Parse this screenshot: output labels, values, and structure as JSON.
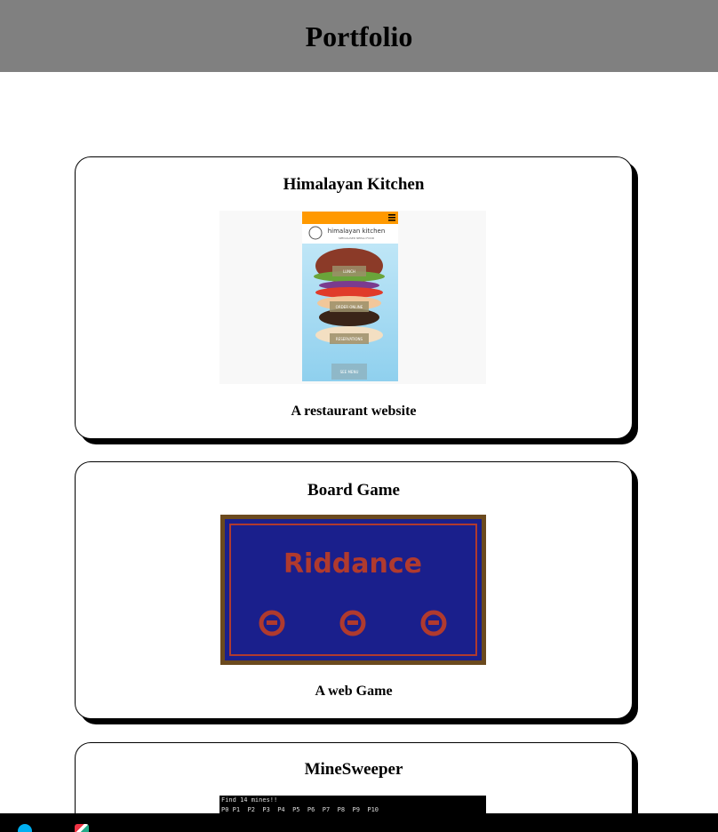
{
  "header": {
    "title": "Portfolio"
  },
  "projects": [
    {
      "title": "Himalayan Kitchen",
      "description": "A restaurant website",
      "preview": {
        "brand": "himalayan kitchen",
        "tagline": "SPECIALISED NEPALI FOOD",
        "buttons": [
          "LUNCH",
          "ORDER ONLINE",
          "RESERVATIONS",
          "SEE MENU"
        ]
      }
    },
    {
      "title": "Board Game",
      "description": "A web Game",
      "preview": {
        "logo": "Riddance"
      }
    },
    {
      "title": "MineSweeper",
      "description": "",
      "preview": {
        "line1": "Find 14 mines!!",
        "line2": "P0 P1  P2  P3  P4  P5  P6  P7  P8  P9  P10"
      }
    }
  ],
  "colors": {
    "header_bg": "#808080",
    "hk_orange": "#ff9900",
    "game_blue": "#1a1f8c",
    "game_red": "#b03a2e",
    "game_wood": "#6b4a1e"
  }
}
